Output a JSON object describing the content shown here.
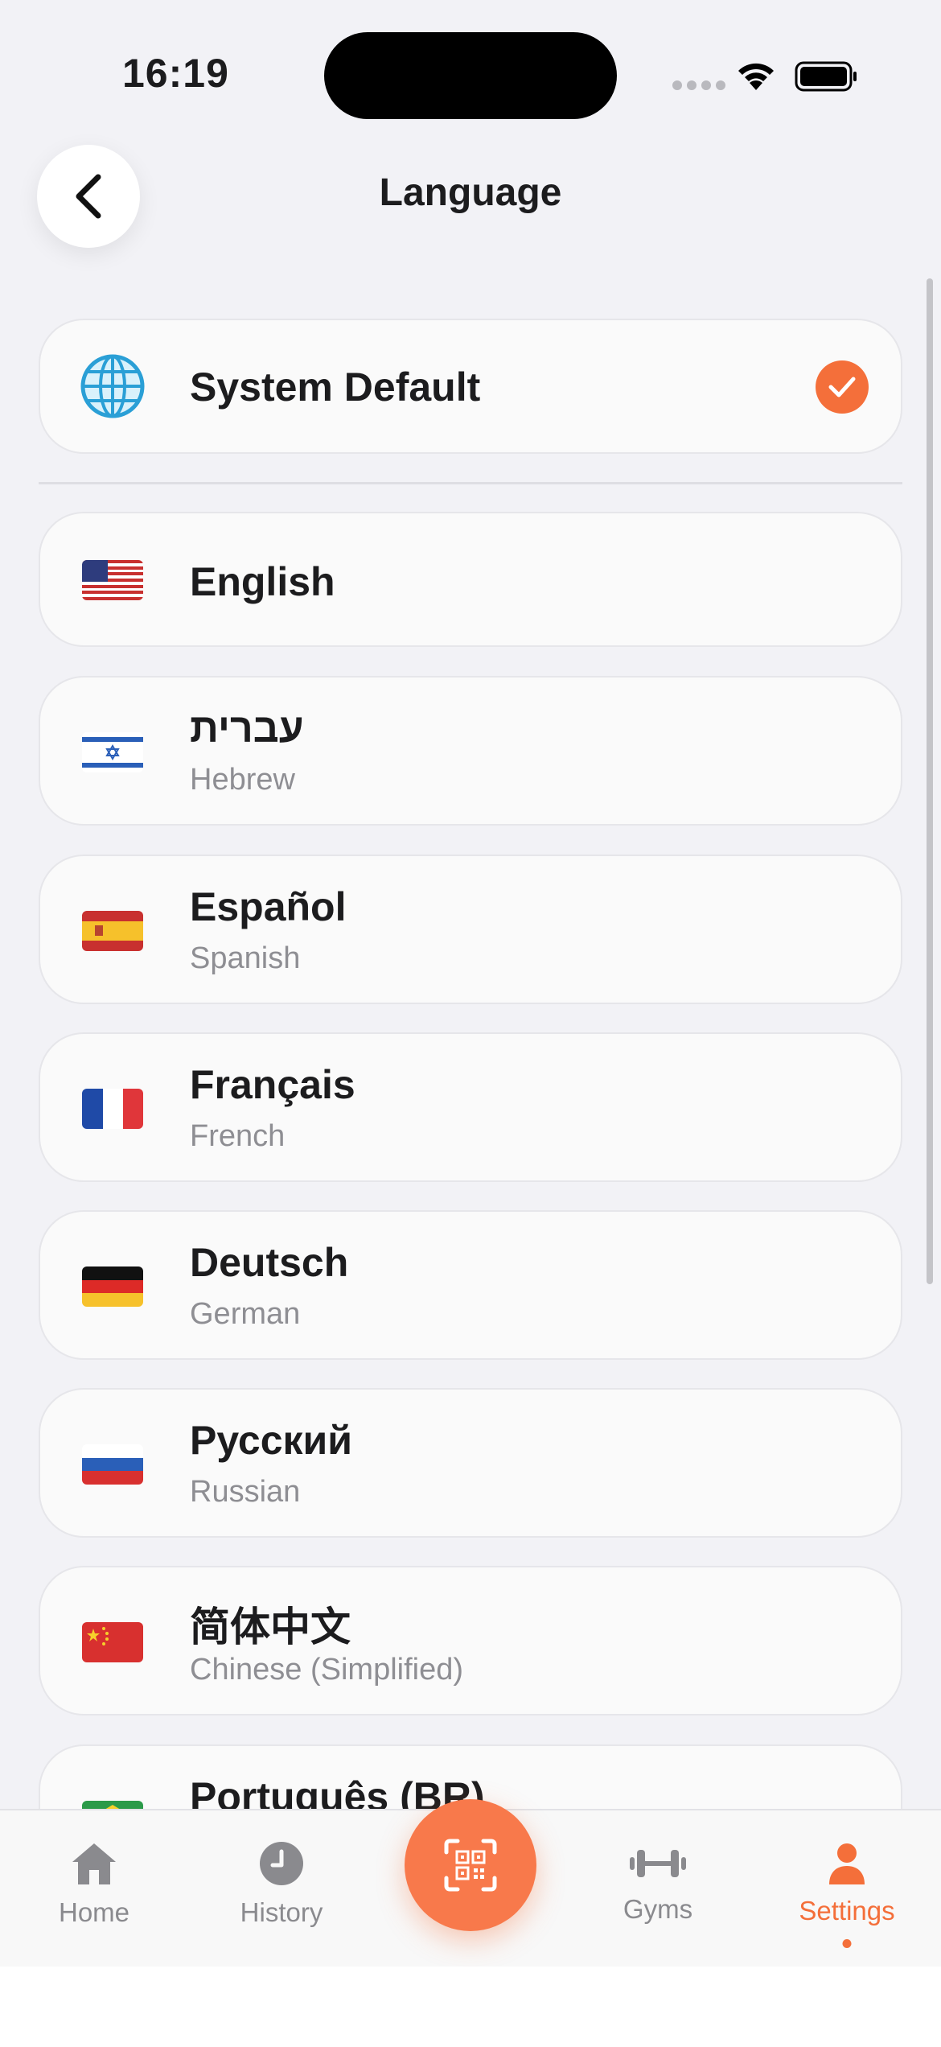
{
  "status_bar": {
    "time": "16:19"
  },
  "header": {
    "title": "Language"
  },
  "system_default": {
    "label": "System Default",
    "selected": true
  },
  "languages": [
    {
      "name": "English",
      "sub": "",
      "flag": "us-flag"
    },
    {
      "name": "עברית",
      "sub": "Hebrew",
      "flag": "il-flag"
    },
    {
      "name": "Español",
      "sub": "Spanish",
      "flag": "es-flag"
    },
    {
      "name": "Français",
      "sub": "French",
      "flag": "fr-flag"
    },
    {
      "name": "Deutsch",
      "sub": "German",
      "flag": "de-flag"
    },
    {
      "name": "Русский",
      "sub": "Russian",
      "flag": "ru-flag"
    },
    {
      "name": "简体中文",
      "sub": "Chinese (Simplified)",
      "flag": "cn-flag"
    },
    {
      "name": "Português (BR)",
      "sub": "",
      "flag": "br-flag"
    }
  ],
  "tab_bar": {
    "tabs": [
      {
        "label": "Home",
        "icon": "home-icon"
      },
      {
        "label": "History",
        "icon": "clock-icon"
      },
      {
        "label": "Gyms",
        "icon": "dumbbell-icon"
      },
      {
        "label": "Settings",
        "icon": "person-icon",
        "active": true
      }
    ],
    "center_button_icon": "qr-scan-icon"
  },
  "colors": {
    "accent": "#f46f3a",
    "background": "#f2f2f6",
    "card": "#fafafa"
  }
}
